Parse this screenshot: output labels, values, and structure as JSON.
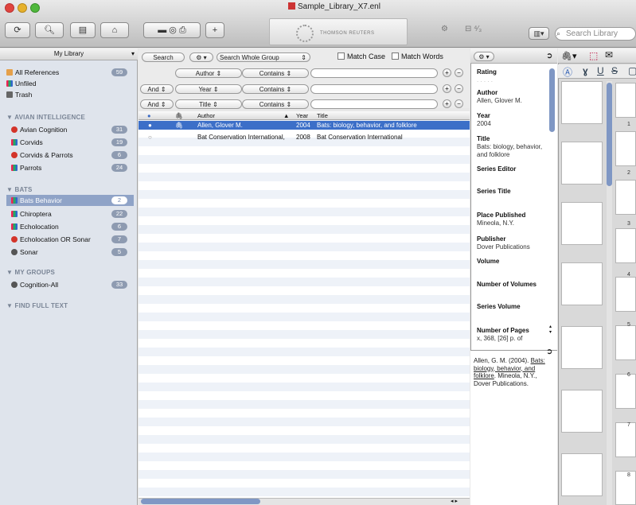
{
  "window": {
    "title": "Sample_Library_X7.enl",
    "banner": "THOMSON REUTERS"
  },
  "toolbar": {
    "search_placeholder": "Search Library"
  },
  "sidebar": {
    "header": "My Library",
    "top_items": [
      {
        "label": "All References",
        "count": "59"
      },
      {
        "label": "Unfiled",
        "count": ""
      },
      {
        "label": "Trash",
        "count": ""
      }
    ],
    "groups": [
      {
        "title": "AVIAN INTELLIGENCE",
        "items": [
          {
            "label": "Avian Cognition",
            "count": "31"
          },
          {
            "label": "Corvids",
            "count": "19"
          },
          {
            "label": "Corvids & Parrots",
            "count": "6"
          },
          {
            "label": "Parrots",
            "count": "24"
          }
        ]
      },
      {
        "title": "BATS",
        "items": [
          {
            "label": "Bats Behavior",
            "count": "2"
          },
          {
            "label": "Chiroptera",
            "count": "22"
          },
          {
            "label": "Echolocation",
            "count": "6"
          },
          {
            "label": "Echolocation OR Sonar",
            "count": "7"
          },
          {
            "label": "Sonar",
            "count": "5"
          }
        ]
      },
      {
        "title": "MY GROUPS",
        "items": [
          {
            "label": "Cognition-All",
            "count": "33"
          }
        ]
      },
      {
        "title": "FIND FULL TEXT",
        "items": []
      }
    ]
  },
  "search": {
    "search_button": "Search",
    "scope": "Search Whole Group",
    "match_case": "Match Case",
    "match_words": "Match Words",
    "rows": [
      {
        "bool": "",
        "field": "Author",
        "op": "Contains"
      },
      {
        "bool": "And",
        "field": "Year",
        "op": "Contains"
      },
      {
        "bool": "And",
        "field": "Title",
        "op": "Contains"
      }
    ]
  },
  "table": {
    "headers": {
      "author": "Author",
      "year": "Year",
      "title": "Title"
    },
    "rows": [
      {
        "author": "Allen, Glover M.",
        "year": "2004",
        "title": "Bats: biology, behavior, and folklore",
        "selected": true
      },
      {
        "author": "Bat Conservation International,",
        "year": "2008",
        "title": "Bat Conservation International",
        "selected": false
      }
    ]
  },
  "reference": {
    "fields": [
      {
        "label": "Rating",
        "value": ". . . . ."
      },
      {
        "label": "Author",
        "value": "Allen, Glover M."
      },
      {
        "label": "Year",
        "value": "2004"
      },
      {
        "label": "Title",
        "value": "Bats: biology, behavior, and folklore"
      },
      {
        "label": "Series Editor",
        "value": ""
      },
      {
        "label": "Series Title",
        "value": ""
      },
      {
        "label": "Place Published",
        "value": "Mineola, N.Y."
      },
      {
        "label": "Publisher",
        "value": "Dover Publications"
      },
      {
        "label": "Volume",
        "value": ""
      },
      {
        "label": "Number of Volumes",
        "value": ""
      },
      {
        "label": "Series Volume",
        "value": ""
      },
      {
        "label": "Number of Pages",
        "value": "x, 368, [26] p. of"
      }
    ],
    "preview_plain_1": "Allen, G. M. (2004).",
    "preview_link": "Bats: biology, behavior, and folklore",
    "preview_plain_2": ". Mineola, N.Y., Dover Publications."
  },
  "pdf": {
    "page_numbers": [
      "1",
      "2",
      "3",
      "4",
      "5",
      "6",
      "7",
      "8"
    ]
  }
}
